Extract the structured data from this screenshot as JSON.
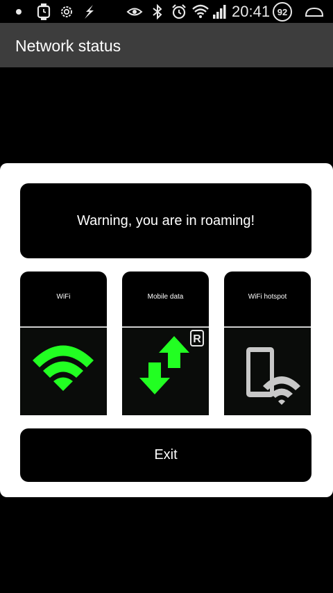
{
  "status_bar": {
    "time": "20:41",
    "battery_level": "92",
    "icons": [
      "notification-dot-icon",
      "smartwatch-icon",
      "settings-gear-icon",
      "flash-icon",
      "eye-icon",
      "bluetooth-icon",
      "alarm-clock-icon",
      "wifi-signal-icon",
      "cellular-signal-icon",
      "battery-icon",
      "home-outline-icon"
    ]
  },
  "action_bar": {
    "title": "Network status"
  },
  "dialog": {
    "warning": "Warning, you are in roaming!",
    "tiles": [
      {
        "label": "WiFi",
        "icon": "wifi-icon"
      },
      {
        "label": "Mobile data",
        "icon": "mobile-data-arrows-icon",
        "badge": "R"
      },
      {
        "label": "WiFi hotspot",
        "icon": "phone-hotspot-icon"
      }
    ],
    "exit_label": "Exit"
  },
  "colors": {
    "accent_green": "#22ff22",
    "action_bar": "#3d3d3d",
    "background": "#000000",
    "dialog": "#ffffff"
  }
}
